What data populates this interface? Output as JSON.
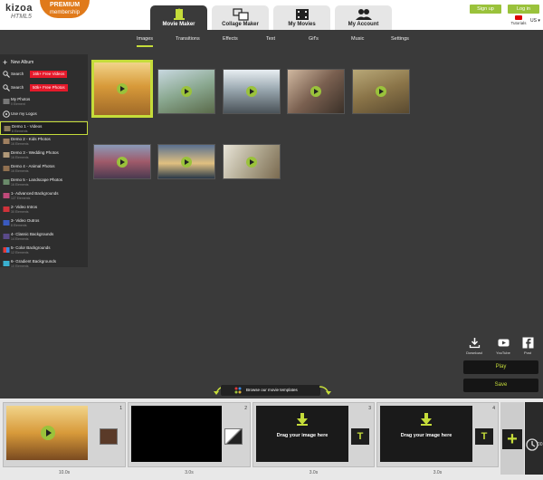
{
  "app": {
    "logo_line1": "kizoa",
    "logo_line2": "HTML5",
    "premium_line1": "PREMIUM",
    "premium_line2": "membership"
  },
  "nav": {
    "tabs": [
      {
        "label": "Movie Maker",
        "icon": "film-icon"
      },
      {
        "label": "Collage Maker",
        "icon": "collage-icon"
      },
      {
        "label": "My Movies",
        "icon": "filmstrip-icon"
      },
      {
        "label": "My Account",
        "icon": "users-icon"
      }
    ],
    "signup": "Sign up",
    "login": "Log in",
    "tutorials": "Tutorials",
    "language": "US"
  },
  "subtabs": [
    "Images",
    "Transitions",
    "Effects",
    "Text",
    "Gif's",
    "Music",
    "Settings"
  ],
  "sidebar": {
    "new_album": "New Album",
    "search_items": [
      {
        "label": "Search",
        "tag": "16k+ Free Videos"
      },
      {
        "label": "Search",
        "tag": "50k+ Free Photos"
      }
    ],
    "my_photos": {
      "title": "My Photos",
      "subtitle": "0 Element"
    },
    "my_logos": {
      "title": "Use my Logos",
      "subtitle": ""
    },
    "albums": [
      {
        "title": "Demo 1 - Videos",
        "subtitle": "8 Elements"
      },
      {
        "title": "Demo 2 - Kids Photos",
        "subtitle": "16 Elements"
      },
      {
        "title": "Demo 3 - Wedding Photos",
        "subtitle": "16 Elements"
      },
      {
        "title": "Demo 4 - Animal Photos",
        "subtitle": "16 Elements"
      },
      {
        "title": "Demo 5 - Landscape Photos",
        "subtitle": "16 Elements"
      },
      {
        "title": "1- Advanced Backgrounds",
        "subtitle": "127 Elements"
      },
      {
        "title": "2- Video Intros",
        "subtitle": "30 Elements"
      },
      {
        "title": "3- Video Outros",
        "subtitle": "8 Elements"
      },
      {
        "title": "4- Classic Backgrounds",
        "subtitle": "14 Elements"
      },
      {
        "title": "5- Color Backgrounds",
        "subtitle": "12 Elements"
      },
      {
        "title": "6- Gradient Backgrounds",
        "subtitle": "10 Elements"
      }
    ]
  },
  "actions": {
    "download": "Download",
    "youtube": "YouTube",
    "post": "Post",
    "play": "Play",
    "save": "Save"
  },
  "browse": "Browse our movie templates",
  "timeline": {
    "frames": [
      {
        "num": "1",
        "duration": "10.0s",
        "kind": "video"
      },
      {
        "num": "2",
        "duration": "3.0s",
        "kind": "black"
      },
      {
        "num": "3",
        "duration": "3.0s",
        "kind": "drop",
        "text": "Drag your image here"
      },
      {
        "num": "4",
        "duration": "3.0s",
        "kind": "drop",
        "text": "Drag your image here"
      }
    ],
    "text_button": "T",
    "add_button": "+",
    "next_duration": "00"
  },
  "colors": {
    "accent": "#c5dc3a",
    "green_button": "#9ac23b",
    "red_tag": "#e5192a",
    "premium": "#e07a1a"
  }
}
